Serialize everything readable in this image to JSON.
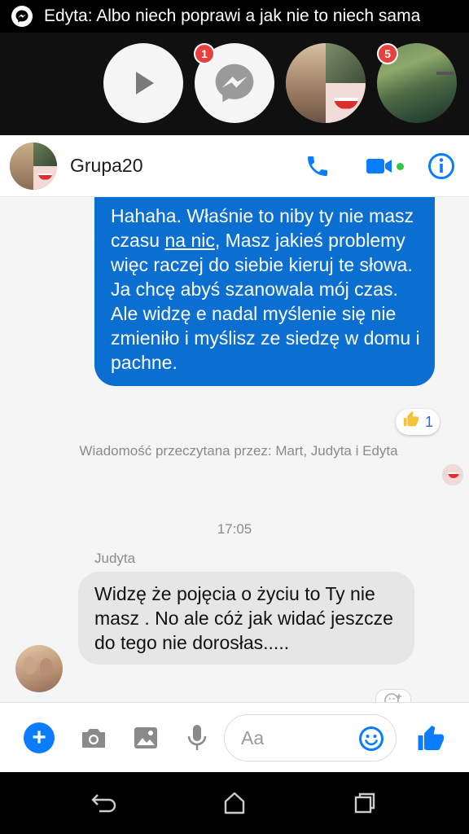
{
  "notification": {
    "icon": "messenger-icon",
    "text": "Edyta: Albo niech poprawi a jak nie to niech sama"
  },
  "chat_heads": {
    "messenger_badge": "1",
    "lake_badge": "5"
  },
  "header": {
    "title": "Grupa20",
    "call_icon": "phone-icon",
    "video_icon": "video-camera-icon",
    "info_icon": "info-icon"
  },
  "messages": {
    "outgoing": {
      "part1": "Hahaha. Właśnie to niby ty nie masz czasu ",
      "underlined": "na nic",
      "part2": ", Masz jakieś problemy więc raczej do siebie kieruj te słowa. Ja chcę abyś szanowala mój czas. Ale widzę e nadal myślenie się nie zmieniło i myślisz ze siedzę w domu i pachne.",
      "reaction_count": "1"
    },
    "seen_by": "Wiadomość przeczytana przez: Mart, Judyta i Edyta",
    "timestamp": "17:05",
    "incoming": {
      "sender": "Judyta",
      "text": "Widzę że pojęcia o życiu to Ty nie masz . No ale cóż jak widać jeszcze do tego nie dorosłas....."
    }
  },
  "composer": {
    "placeholder": "Aa"
  },
  "colors": {
    "accent": "#0a7cff",
    "outgoing_bubble": "#0a6fd1",
    "incoming_bubble": "#e6e6e6",
    "badge": "#e8403d",
    "online": "#31c44a"
  }
}
